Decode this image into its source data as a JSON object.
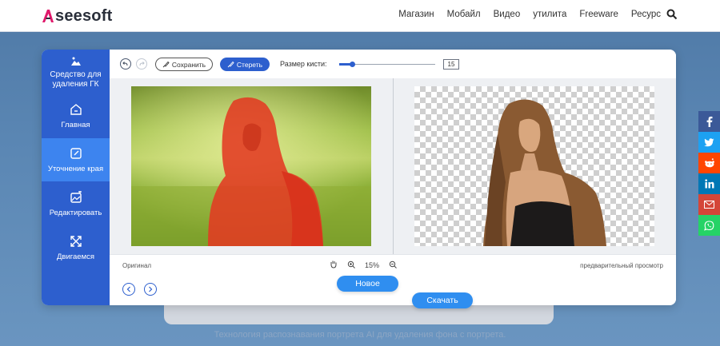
{
  "brand": {
    "name": "seesoft"
  },
  "nav": {
    "items": [
      {
        "label": "Магазин"
      },
      {
        "label": "Мобайл"
      },
      {
        "label": "Видео"
      },
      {
        "label": "утилита"
      },
      {
        "label": "Freeware"
      },
      {
        "label": "Ресурс"
      }
    ]
  },
  "sidebar": {
    "title": "Средство для удаления ГК",
    "items": [
      {
        "label": "Главная",
        "icon": "home-icon"
      },
      {
        "label": "Уточнение края",
        "icon": "edit-edge-icon",
        "active": true
      },
      {
        "label": "Редактировать",
        "icon": "image-edit-icon"
      },
      {
        "label": "Двигаемся",
        "icon": "move-icon"
      }
    ]
  },
  "toolbar": {
    "save_label": "Сохранить",
    "erase_label": "Стереть",
    "brush_label": "Размер кисти:",
    "brush_value": "15",
    "brush_fraction": 0.13
  },
  "status": {
    "left": "Оригинал",
    "zoom": "15%",
    "right": "предварительный просмотр"
  },
  "actions": {
    "new_label": "Новое",
    "download_label": "Скачать"
  },
  "tagline": "Технология распознавания портрета AI для удаления фона с портрета.",
  "share": [
    "facebook",
    "twitter",
    "reddit",
    "linkedin",
    "gmail",
    "whatsapp"
  ],
  "colors": {
    "accent": "#2d5fce",
    "active": "#3d84ef",
    "button": "#2f8ef0"
  }
}
